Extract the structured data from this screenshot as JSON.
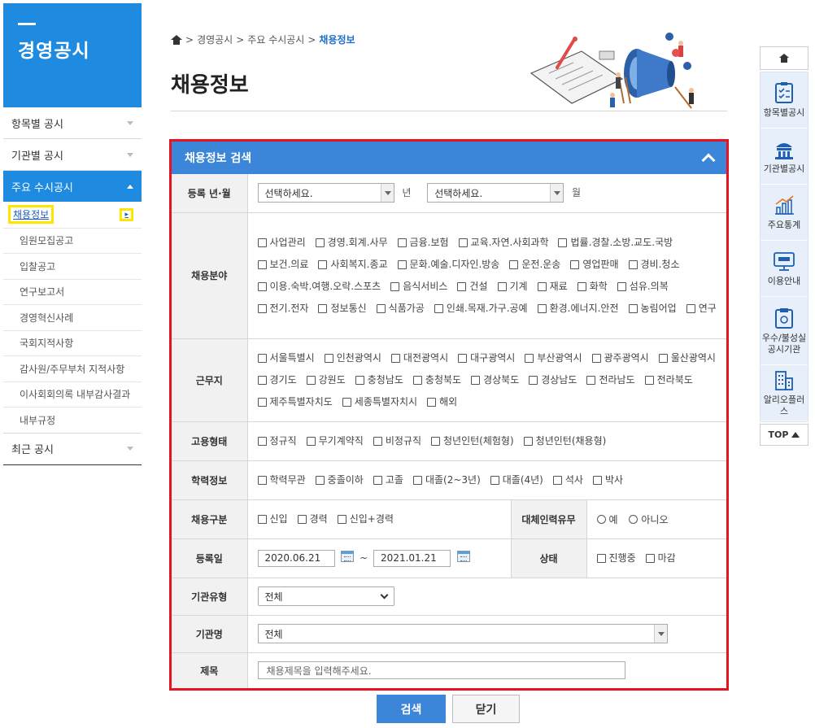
{
  "sidebar": {
    "title": "경영공시",
    "menu": [
      {
        "label": "항목별 공시"
      },
      {
        "label": "기관별 공시"
      },
      {
        "label": "주요 수시공시"
      },
      {
        "label": "최근 공시"
      }
    ],
    "sub": [
      "채용정보",
      "임원모집공고",
      "입찰공고",
      "연구보고서",
      "경영혁신사례",
      "국회지적사항",
      "감사원/주무부처 지적사항",
      "이사회회의록 내부감사결과",
      "내부규정"
    ]
  },
  "breadcrumb": {
    "items": [
      "경영공시",
      "주요 수시공시"
    ],
    "current": "채용정보"
  },
  "page_title": "채용정보",
  "panel": {
    "title": "채용정보 검색",
    "rows": {
      "reg_month": {
        "label": "등록 년·월",
        "year_select": "선택하세요.",
        "year_unit": "년",
        "month_select": "선택하세요.",
        "month_unit": "월"
      },
      "field": {
        "label": "채용분야",
        "options": [
          "사업관리",
          "경영.회계.사무",
          "금융.보험",
          "교육.자연.사회과학",
          "법률.경찰.소방.교도.국방",
          "보건.의료",
          "사회복지.종교",
          "문화.예술.디자인.방송",
          "운전.운송",
          "영업판매",
          "경비.청소",
          "이용.숙박.여행.오락.스포츠",
          "음식서비스",
          "건설",
          "기계",
          "재료",
          "화학",
          "섬유.의복",
          "전기.전자",
          "정보통신",
          "식품가공",
          "인쇄.목재.가구.공예",
          "환경.에너지.안전",
          "농림어업",
          "연구"
        ]
      },
      "location": {
        "label": "근무지",
        "options": [
          "서울특별시",
          "인천광역시",
          "대전광역시",
          "대구광역시",
          "부산광역시",
          "광주광역시",
          "울산광역시",
          "경기도",
          "강원도",
          "충청남도",
          "충청북도",
          "경상북도",
          "경상남도",
          "전라남도",
          "전라북도",
          "제주특별자치도",
          "세종특별자치시",
          "해외"
        ]
      },
      "employment": {
        "label": "고용형태",
        "options": [
          "정규직",
          "무기계약직",
          "비정규직",
          "청년인턴(체험형)",
          "청년인턴(채용형)"
        ]
      },
      "education": {
        "label": "학력정보",
        "options": [
          "학력무관",
          "중졸이하",
          "고졸",
          "대졸(2~3년)",
          "대졸(4년)",
          "석사",
          "박사"
        ]
      },
      "recruit_type": {
        "label": "채용구분",
        "options": [
          "신입",
          "경력",
          "신입+경력"
        ],
        "sub_label": "대체인력유무",
        "radios": [
          "예",
          "아니오"
        ]
      },
      "reg_date": {
        "label": "등록일",
        "from": "2020.06.21",
        "tilde": "~",
        "to": "2021.01.21",
        "sub_label": "상태",
        "options": [
          "진행중",
          "마감"
        ]
      },
      "org_type": {
        "label": "기관유형",
        "value": "전체"
      },
      "org_name": {
        "label": "기관명",
        "value": "전체"
      },
      "subject": {
        "label": "제목",
        "placeholder": "채용제목을 입력해주세요."
      }
    }
  },
  "buttons": {
    "search": "검색",
    "close": "닫기"
  },
  "quick_menu": {
    "items": [
      "항목별공시",
      "기관별공시",
      "주요통계",
      "이용안내",
      "우수/불성실 공시기관",
      "알리오플러스"
    ],
    "top": "TOP"
  },
  "colors": {
    "primary": "#1e8be0",
    "panel_head": "#3b86d8",
    "highlight_border": "#e8131e",
    "current_box": "#ffe600"
  }
}
